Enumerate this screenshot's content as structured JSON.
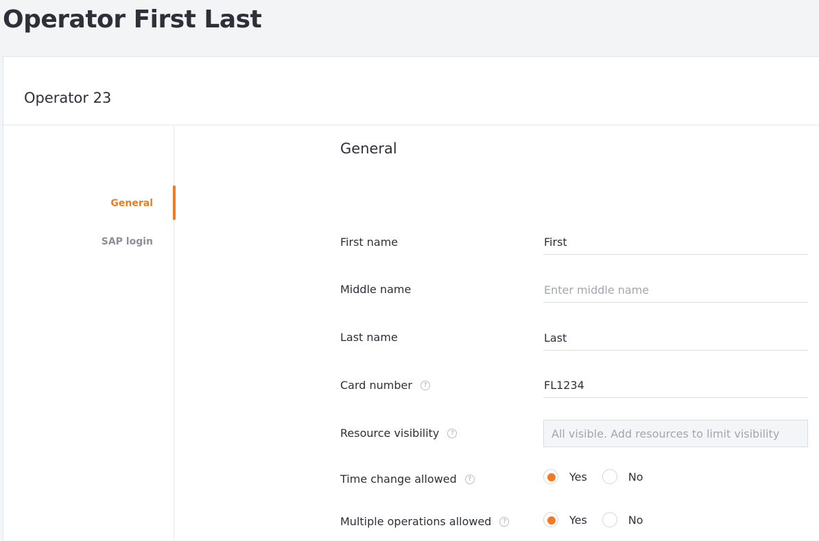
{
  "page": {
    "title": "Operator First Last"
  },
  "card": {
    "title": "Operator 23"
  },
  "nav": {
    "items": [
      {
        "label": "General",
        "active": true
      },
      {
        "label": "SAP login",
        "active": false
      }
    ]
  },
  "form": {
    "section_title": "General",
    "first_name": {
      "label": "First name",
      "value": "First"
    },
    "middle_name": {
      "label": "Middle name",
      "value": "",
      "placeholder": "Enter middle name"
    },
    "last_name": {
      "label": "Last name",
      "value": "Last"
    },
    "card_number": {
      "label": "Card number",
      "value": "FL1234"
    },
    "resource_visibility": {
      "label": "Resource visibility",
      "placeholder": "All visible. Add resources to limit visibility"
    },
    "time_change_allowed": {
      "label": "Time change allowed",
      "yes": "Yes",
      "no": "No",
      "selected": "Yes"
    },
    "multiple_operations_allowed": {
      "label": "Multiple operations allowed",
      "yes": "Yes",
      "no": "No",
      "selected": "Yes"
    }
  },
  "icons": {
    "help": "help-icon",
    "help_glyph": "?"
  },
  "colors": {
    "accent": "#f07b22",
    "text": "#2d3038",
    "muted": "#8a8f99"
  }
}
